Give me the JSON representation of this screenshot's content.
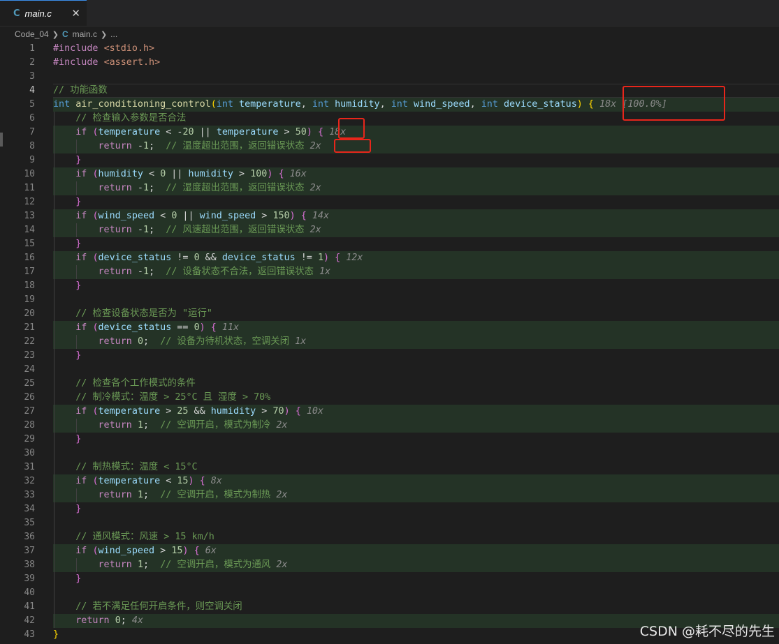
{
  "tab": {
    "lang": "C",
    "filename": "main.c",
    "close": "✕"
  },
  "breadcrumb": {
    "folder": "Code_04",
    "lang": "C",
    "file": "main.c",
    "more": "..."
  },
  "editor": {
    "lines": [
      {
        "n": "1",
        "t": [
          [
            "pp",
            "#include "
          ],
          [
            "inc",
            "<stdio.h>"
          ]
        ]
      },
      {
        "n": "2",
        "t": [
          [
            "pp",
            "#include "
          ],
          [
            "inc",
            "<assert.h>"
          ]
        ]
      },
      {
        "n": "3",
        "t": []
      },
      {
        "n": "4",
        "t": [
          [
            "com",
            "// 功能函数"
          ]
        ]
      },
      {
        "n": "5",
        "t": [
          [
            "kw",
            "int"
          ],
          [
            "op",
            " "
          ],
          [
            "fn",
            "air_conditioning_control"
          ],
          [
            "b1",
            "("
          ],
          [
            "kw",
            "int"
          ],
          [
            "op",
            " "
          ],
          [
            "var",
            "temperature"
          ],
          [
            "op",
            ", "
          ],
          [
            "kw",
            "int"
          ],
          [
            "op",
            " "
          ],
          [
            "var",
            "humidity"
          ],
          [
            "op",
            ", "
          ],
          [
            "kw",
            "int"
          ],
          [
            "op",
            " "
          ],
          [
            "var",
            "wind_speed"
          ],
          [
            "op",
            ", "
          ],
          [
            "kw",
            "int"
          ],
          [
            "op",
            " "
          ],
          [
            "var",
            "device_status"
          ],
          [
            "b1",
            ")"
          ],
          [
            "op",
            " "
          ],
          [
            "b1",
            "{"
          ],
          [
            "op",
            " "
          ],
          [
            "cnt",
            "18x [100.0%]"
          ]
        ]
      },
      {
        "n": "6",
        "t": [
          [
            "op",
            "    "
          ],
          [
            "com",
            "// 检查输入参数是否合法"
          ]
        ]
      },
      {
        "n": "7",
        "t": [
          [
            "op",
            "    "
          ],
          [
            "ctl",
            "if"
          ],
          [
            "op",
            " "
          ],
          [
            "b2",
            "("
          ],
          [
            "var",
            "temperature"
          ],
          [
            "op",
            " < -"
          ],
          [
            "num",
            "20"
          ],
          [
            "op",
            " || "
          ],
          [
            "var",
            "temperature"
          ],
          [
            "op",
            " > "
          ],
          [
            "num",
            "50"
          ],
          [
            "b2",
            ")"
          ],
          [
            "op",
            " "
          ],
          [
            "b2",
            "{"
          ],
          [
            "op",
            " "
          ],
          [
            "cnt",
            "18x"
          ]
        ]
      },
      {
        "n": "8",
        "t": [
          [
            "op",
            "        "
          ],
          [
            "ctl",
            "return"
          ],
          [
            "op",
            " -"
          ],
          [
            "num",
            "1"
          ],
          [
            "op",
            ";  "
          ],
          [
            "com",
            "// 温度超出范围，返回错误状态"
          ],
          [
            "op",
            " "
          ],
          [
            "cnt",
            "2x"
          ]
        ]
      },
      {
        "n": "9",
        "t": [
          [
            "op",
            "    "
          ],
          [
            "b2",
            "}"
          ]
        ]
      },
      {
        "n": "10",
        "t": [
          [
            "op",
            "    "
          ],
          [
            "ctl",
            "if"
          ],
          [
            "op",
            " "
          ],
          [
            "b2",
            "("
          ],
          [
            "var",
            "humidity"
          ],
          [
            "op",
            " < "
          ],
          [
            "num",
            "0"
          ],
          [
            "op",
            " || "
          ],
          [
            "var",
            "humidity"
          ],
          [
            "op",
            " > "
          ],
          [
            "num",
            "100"
          ],
          [
            "b2",
            ")"
          ],
          [
            "op",
            " "
          ],
          [
            "b2",
            "{"
          ],
          [
            "op",
            " "
          ],
          [
            "cnt",
            "16x"
          ]
        ]
      },
      {
        "n": "11",
        "t": [
          [
            "op",
            "        "
          ],
          [
            "ctl",
            "return"
          ],
          [
            "op",
            " -"
          ],
          [
            "num",
            "1"
          ],
          [
            "op",
            ";  "
          ],
          [
            "com",
            "// 湿度超出范围，返回错误状态"
          ],
          [
            "op",
            " "
          ],
          [
            "cnt",
            "2x"
          ]
        ]
      },
      {
        "n": "12",
        "t": [
          [
            "op",
            "    "
          ],
          [
            "b2",
            "}"
          ]
        ]
      },
      {
        "n": "13",
        "t": [
          [
            "op",
            "    "
          ],
          [
            "ctl",
            "if"
          ],
          [
            "op",
            " "
          ],
          [
            "b2",
            "("
          ],
          [
            "var",
            "wind_speed"
          ],
          [
            "op",
            " < "
          ],
          [
            "num",
            "0"
          ],
          [
            "op",
            " || "
          ],
          [
            "var",
            "wind_speed"
          ],
          [
            "op",
            " > "
          ],
          [
            "num",
            "150"
          ],
          [
            "b2",
            ")"
          ],
          [
            "op",
            " "
          ],
          [
            "b2",
            "{"
          ],
          [
            "op",
            " "
          ],
          [
            "cnt",
            "14x"
          ]
        ]
      },
      {
        "n": "14",
        "t": [
          [
            "op",
            "        "
          ],
          [
            "ctl",
            "return"
          ],
          [
            "op",
            " -"
          ],
          [
            "num",
            "1"
          ],
          [
            "op",
            ";  "
          ],
          [
            "com",
            "// 风速超出范围，返回错误状态"
          ],
          [
            "op",
            " "
          ],
          [
            "cnt",
            "2x"
          ]
        ]
      },
      {
        "n": "15",
        "t": [
          [
            "op",
            "    "
          ],
          [
            "b2",
            "}"
          ]
        ]
      },
      {
        "n": "16",
        "t": [
          [
            "op",
            "    "
          ],
          [
            "ctl",
            "if"
          ],
          [
            "op",
            " "
          ],
          [
            "b2",
            "("
          ],
          [
            "var",
            "device_status"
          ],
          [
            "op",
            " != "
          ],
          [
            "num",
            "0"
          ],
          [
            "op",
            " && "
          ],
          [
            "var",
            "device_status"
          ],
          [
            "op",
            " != "
          ],
          [
            "num",
            "1"
          ],
          [
            "b2",
            ")"
          ],
          [
            "op",
            " "
          ],
          [
            "b2",
            "{"
          ],
          [
            "op",
            " "
          ],
          [
            "cnt",
            "12x"
          ]
        ]
      },
      {
        "n": "17",
        "t": [
          [
            "op",
            "        "
          ],
          [
            "ctl",
            "return"
          ],
          [
            "op",
            " -"
          ],
          [
            "num",
            "1"
          ],
          [
            "op",
            ";  "
          ],
          [
            "com",
            "// 设备状态不合法，返回错误状态"
          ],
          [
            "op",
            " "
          ],
          [
            "cnt",
            "1x"
          ]
        ]
      },
      {
        "n": "18",
        "t": [
          [
            "op",
            "    "
          ],
          [
            "b2",
            "}"
          ]
        ]
      },
      {
        "n": "19",
        "t": []
      },
      {
        "n": "20",
        "t": [
          [
            "op",
            "    "
          ],
          [
            "com",
            "// 检查设备状态是否为 \"运行\""
          ]
        ]
      },
      {
        "n": "21",
        "t": [
          [
            "op",
            "    "
          ],
          [
            "ctl",
            "if"
          ],
          [
            "op",
            " "
          ],
          [
            "b2",
            "("
          ],
          [
            "var",
            "device_status"
          ],
          [
            "op",
            " == "
          ],
          [
            "num",
            "0"
          ],
          [
            "b2",
            ")"
          ],
          [
            "op",
            " "
          ],
          [
            "b2",
            "{"
          ],
          [
            "op",
            " "
          ],
          [
            "cnt",
            "11x"
          ]
        ]
      },
      {
        "n": "22",
        "t": [
          [
            "op",
            "        "
          ],
          [
            "ctl",
            "return"
          ],
          [
            "op",
            " "
          ],
          [
            "num",
            "0"
          ],
          [
            "op",
            ";  "
          ],
          [
            "com",
            "// 设备为待机状态，空调关闭"
          ],
          [
            "op",
            " "
          ],
          [
            "cnt",
            "1x"
          ]
        ]
      },
      {
        "n": "23",
        "t": [
          [
            "op",
            "    "
          ],
          [
            "b2",
            "}"
          ]
        ]
      },
      {
        "n": "24",
        "t": []
      },
      {
        "n": "25",
        "t": [
          [
            "op",
            "    "
          ],
          [
            "com",
            "// 检查各个工作模式的条件"
          ]
        ]
      },
      {
        "n": "26",
        "t": [
          [
            "op",
            "    "
          ],
          [
            "com",
            "// 制冷模式：温度 > 25°C 且 湿度 > 70%"
          ]
        ]
      },
      {
        "n": "27",
        "t": [
          [
            "op",
            "    "
          ],
          [
            "ctl",
            "if"
          ],
          [
            "op",
            " "
          ],
          [
            "b2",
            "("
          ],
          [
            "var",
            "temperature"
          ],
          [
            "op",
            " > "
          ],
          [
            "num",
            "25"
          ],
          [
            "op",
            " && "
          ],
          [
            "var",
            "humidity"
          ],
          [
            "op",
            " > "
          ],
          [
            "num",
            "70"
          ],
          [
            "b2",
            ")"
          ],
          [
            "op",
            " "
          ],
          [
            "b2",
            "{"
          ],
          [
            "op",
            " "
          ],
          [
            "cnt",
            "10x"
          ]
        ]
      },
      {
        "n": "28",
        "t": [
          [
            "op",
            "        "
          ],
          [
            "ctl",
            "return"
          ],
          [
            "op",
            " "
          ],
          [
            "num",
            "1"
          ],
          [
            "op",
            ";  "
          ],
          [
            "com",
            "// 空调开启，模式为制冷"
          ],
          [
            "op",
            " "
          ],
          [
            "cnt",
            "2x"
          ]
        ]
      },
      {
        "n": "29",
        "t": [
          [
            "op",
            "    "
          ],
          [
            "b2",
            "}"
          ]
        ]
      },
      {
        "n": "30",
        "t": []
      },
      {
        "n": "31",
        "t": [
          [
            "op",
            "    "
          ],
          [
            "com",
            "// 制热模式：温度 < 15°C"
          ]
        ]
      },
      {
        "n": "32",
        "t": [
          [
            "op",
            "    "
          ],
          [
            "ctl",
            "if"
          ],
          [
            "op",
            " "
          ],
          [
            "b2",
            "("
          ],
          [
            "var",
            "temperature"
          ],
          [
            "op",
            " < "
          ],
          [
            "num",
            "15"
          ],
          [
            "b2",
            ")"
          ],
          [
            "op",
            " "
          ],
          [
            "b2",
            "{"
          ],
          [
            "op",
            " "
          ],
          [
            "cnt",
            "8x"
          ]
        ]
      },
      {
        "n": "33",
        "t": [
          [
            "op",
            "        "
          ],
          [
            "ctl",
            "return"
          ],
          [
            "op",
            " "
          ],
          [
            "num",
            "1"
          ],
          [
            "op",
            ";  "
          ],
          [
            "com",
            "// 空调开启，模式为制热"
          ],
          [
            "op",
            " "
          ],
          [
            "cnt",
            "2x"
          ]
        ]
      },
      {
        "n": "34",
        "t": [
          [
            "op",
            "    "
          ],
          [
            "b2",
            "}"
          ]
        ]
      },
      {
        "n": "35",
        "t": []
      },
      {
        "n": "36",
        "t": [
          [
            "op",
            "    "
          ],
          [
            "com",
            "// 通风模式：风速 > 15 km/h"
          ]
        ]
      },
      {
        "n": "37",
        "t": [
          [
            "op",
            "    "
          ],
          [
            "ctl",
            "if"
          ],
          [
            "op",
            " "
          ],
          [
            "b2",
            "("
          ],
          [
            "var",
            "wind_speed"
          ],
          [
            "op",
            " > "
          ],
          [
            "num",
            "15"
          ],
          [
            "b2",
            ")"
          ],
          [
            "op",
            " "
          ],
          [
            "b2",
            "{"
          ],
          [
            "op",
            " "
          ],
          [
            "cnt",
            "6x"
          ]
        ]
      },
      {
        "n": "38",
        "t": [
          [
            "op",
            "        "
          ],
          [
            "ctl",
            "return"
          ],
          [
            "op",
            " "
          ],
          [
            "num",
            "1"
          ],
          [
            "op",
            ";  "
          ],
          [
            "com",
            "// 空调开启，模式为通风"
          ],
          [
            "op",
            " "
          ],
          [
            "cnt",
            "2x"
          ]
        ]
      },
      {
        "n": "39",
        "t": [
          [
            "op",
            "    "
          ],
          [
            "b2",
            "}"
          ]
        ]
      },
      {
        "n": "40",
        "t": []
      },
      {
        "n": "41",
        "t": [
          [
            "op",
            "    "
          ],
          [
            "com",
            "// 若不满足任何开启条件，则空调关闭"
          ]
        ]
      },
      {
        "n": "42",
        "t": [
          [
            "op",
            "    "
          ],
          [
            "ctl",
            "return"
          ],
          [
            "op",
            " "
          ],
          [
            "num",
            "0"
          ],
          [
            "op",
            "; "
          ],
          [
            "cnt",
            "4x"
          ]
        ]
      },
      {
        "n": "43",
        "t": [
          [
            "b1",
            "}"
          ]
        ]
      }
    ],
    "covered_lines": [
      "5",
      "7",
      "8",
      "10",
      "11",
      "13",
      "14",
      "16",
      "17",
      "21",
      "22",
      "27",
      "28",
      "32",
      "33",
      "37",
      "38",
      "42"
    ],
    "active_line": "4"
  },
  "watermark": "CSDN @耗不尽的先生"
}
